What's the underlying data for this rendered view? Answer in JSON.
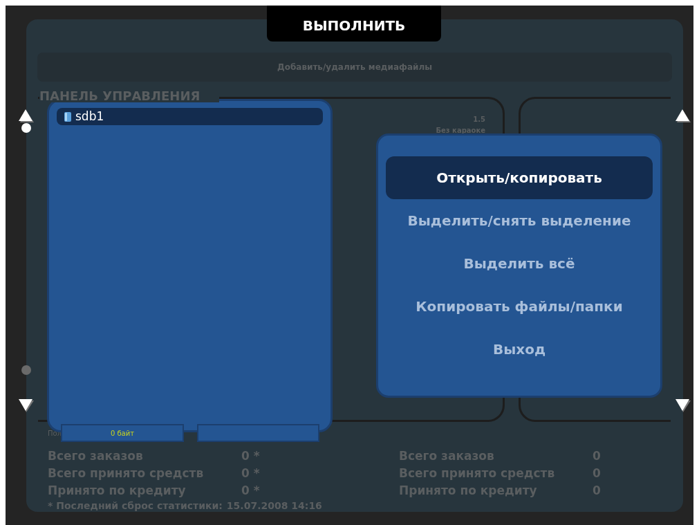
{
  "title_tab": "ВЫПОЛНИТЬ",
  "media_button": "Добавить/удалить медиафайлы",
  "section_title": "ПАНЕЛЬ УПРАВЛЕНИЯ",
  "panel_info": [
    "1.5",
    "Без караоке"
  ],
  "cut_label": "Пол",
  "stats_left": [
    {
      "label": "Всего заказов",
      "value": "0 *"
    },
    {
      "label": "Всего принято средств",
      "value": "0 *"
    },
    {
      "label": "Принято по кредиту",
      "value": "0 *"
    }
  ],
  "stats_right": [
    {
      "label": "Всего заказов",
      "value": "0"
    },
    {
      "label": "Всего принято средств",
      "value": "0"
    },
    {
      "label": "Принято по кредиту",
      "value": "0"
    }
  ],
  "footer": {
    "label": "* Последний сброс статистики:",
    "value": "15.07.2008 14:16"
  },
  "file_panel": {
    "items": [
      {
        "name": "sdb1",
        "selected": true
      }
    ],
    "size": "0 байт"
  },
  "menu": {
    "items": [
      {
        "label": "Открыть/копировать",
        "selected": true
      },
      {
        "label": "Выделить/снять выделение",
        "selected": false
      },
      {
        "label": "Выделить всё",
        "selected": false
      },
      {
        "label": "Копировать файлы/папки",
        "selected": false
      },
      {
        "label": "Выход",
        "selected": false
      }
    ]
  }
}
